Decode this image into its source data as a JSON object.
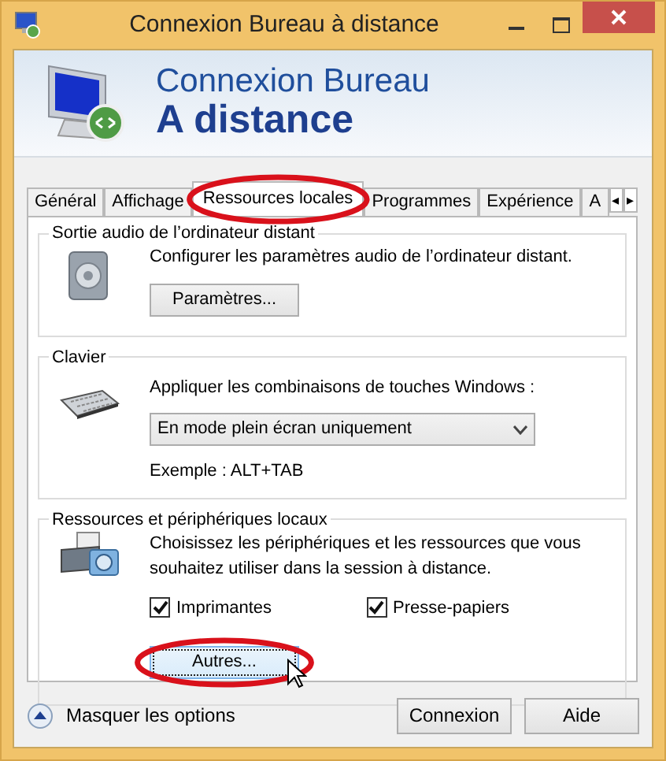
{
  "window": {
    "title": "Connexion Bureau à distance"
  },
  "header": {
    "line1": "Connexion Bureau",
    "line2": "A distance"
  },
  "tabs": [
    {
      "label": "Général",
      "selected": false,
      "circled": false
    },
    {
      "label": "Affichage",
      "selected": false,
      "circled": false
    },
    {
      "label": "Ressources locales",
      "selected": true,
      "circled": true
    },
    {
      "label": "Programmes",
      "selected": false,
      "circled": false
    },
    {
      "label": "Expérience",
      "selected": false,
      "circled": false
    },
    {
      "label": "A",
      "selected": false,
      "circled": false
    }
  ],
  "tab_scroll": [
    "◂",
    "▸"
  ],
  "groups": [
    {
      "kind": "audio",
      "legend": "Sortie audio de l’ordinateur distant",
      "description": "Configurer les paramètres audio de l’ordinateur distant.",
      "button": {
        "label": "Paramètres...",
        "circled": false,
        "hovered": false
      }
    },
    {
      "kind": "keyboard",
      "legend": "Clavier",
      "description": "Appliquer les combinaisons de touches Windows :",
      "select": {
        "value": "En mode plein écran uniquement"
      },
      "example": "Exemple : ALT+TAB"
    },
    {
      "kind": "resources",
      "legend": "Ressources et périphériques locaux",
      "description": "Choisissez les périphériques et les ressources que vous souhaitez utiliser dans la session à distance.",
      "checkboxes": [
        {
          "label": "Imprimantes",
          "checked": true
        },
        {
          "label": "Presse-papiers",
          "checked": true
        }
      ],
      "button": {
        "label": "Autres...",
        "circled": true,
        "hovered": true
      }
    }
  ],
  "footer": {
    "toggle": "Masquer les options",
    "buttons": [
      "Connexion",
      "Aide"
    ]
  }
}
